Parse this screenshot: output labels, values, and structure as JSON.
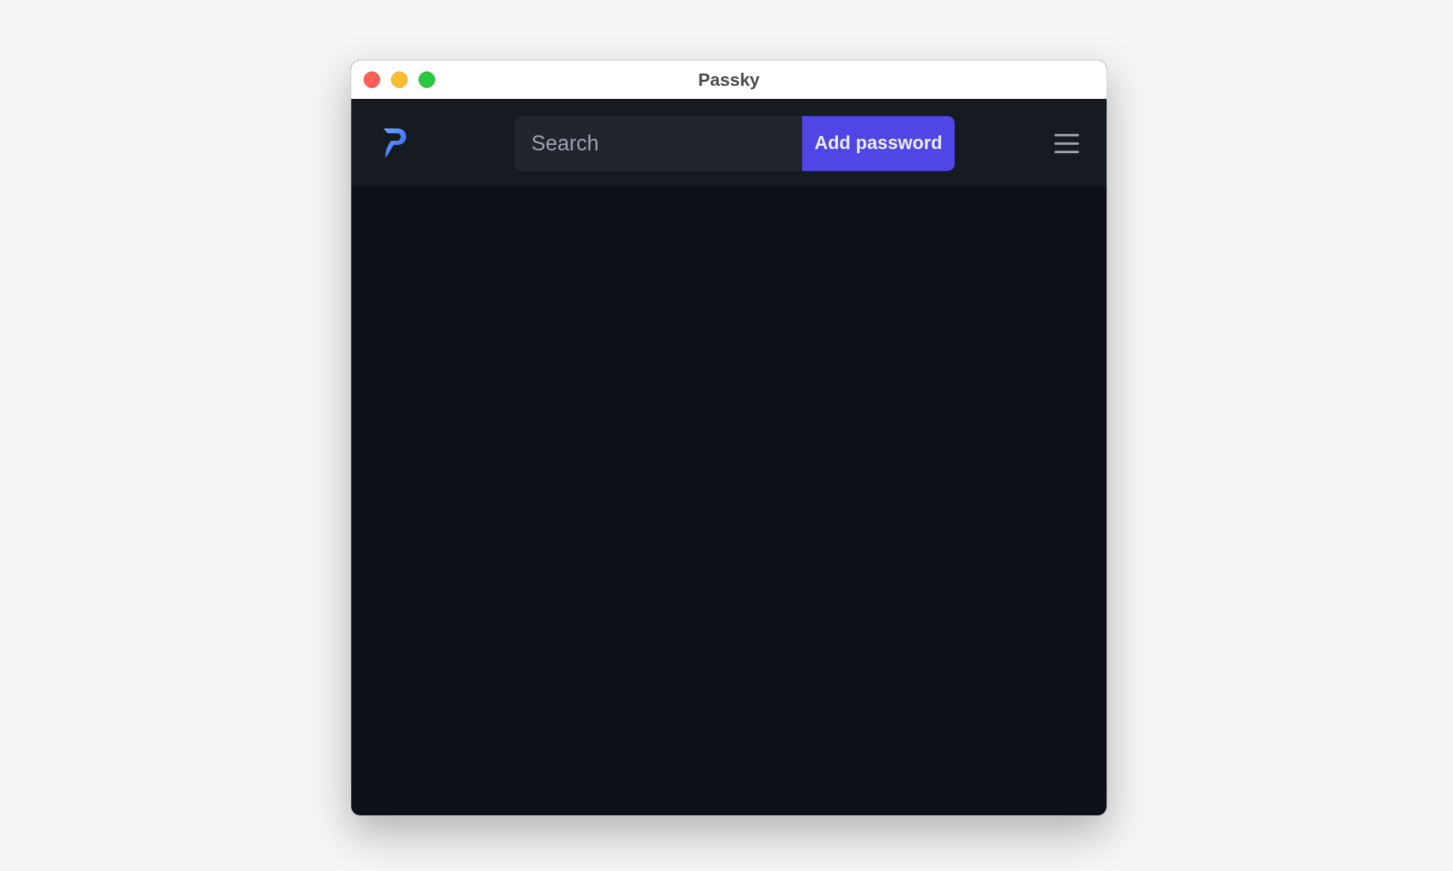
{
  "window": {
    "title": "Passky"
  },
  "header": {
    "search": {
      "placeholder": "Search"
    },
    "add_button": {
      "label": "Add password"
    }
  }
}
